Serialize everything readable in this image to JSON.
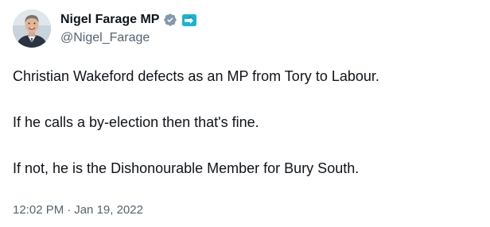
{
  "author": {
    "display_name": "Nigel Farage MP",
    "handle": "@Nigel_Farage",
    "verified_badge_icon": "verified-badge-icon",
    "verified_badge_color": "#829aab",
    "affiliation_badge_icon": "affiliation-arrow-icon",
    "affiliation_badge_color": "#12b6d6"
  },
  "tweet": {
    "paragraphs": [
      "Christian Wakeford defects as an MP from Tory to Labour.",
      "If he calls a by-election then that's fine.",
      "If not, he is the Dishonourable Member for Bury South."
    ],
    "time": "12:02 PM",
    "separator": "·",
    "date": "Jan 19, 2022"
  },
  "colors": {
    "text_primary": "#0f1419",
    "text_secondary": "#536471",
    "background": "#ffffff"
  }
}
